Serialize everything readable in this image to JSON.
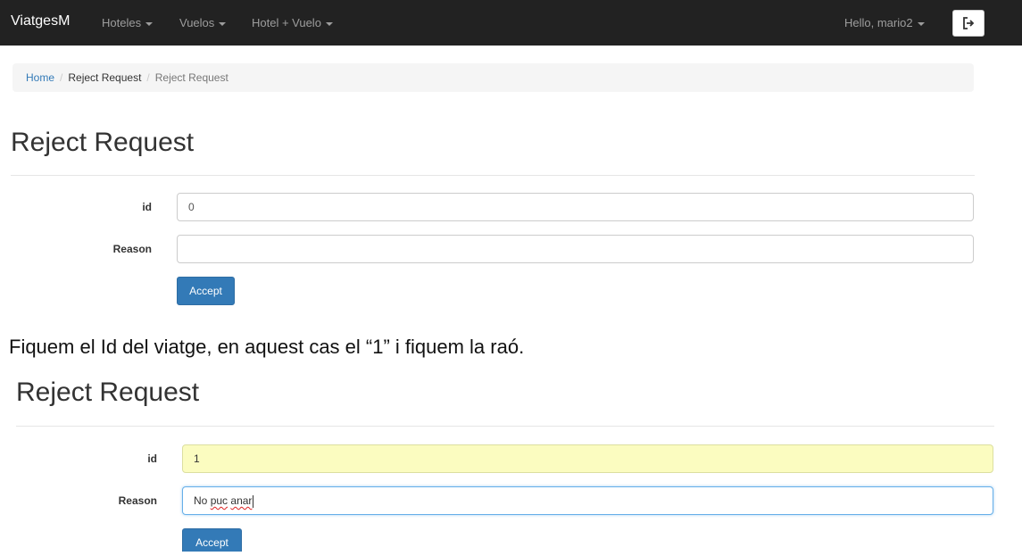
{
  "navbar": {
    "brand": "ViatgesM",
    "items": [
      {
        "label": "Hoteles"
      },
      {
        "label": "Vuelos"
      },
      {
        "label": "Hotel + Vuelo"
      }
    ],
    "user_label": "Hello, mario2",
    "logout_icon": "sign-out-icon"
  },
  "breadcrumb": {
    "home": "Home",
    "middle": "Reject Request",
    "current": "Reject Request"
  },
  "form1": {
    "title": "Reject Request",
    "id_label": "id",
    "id_value": "0",
    "reason_label": "Reason",
    "reason_value": "",
    "accept_label": "Accept"
  },
  "caption": "Fiquem el Id del viatge, en aquest cas el “1” i fiquem la raó.",
  "form2": {
    "title": "Reject Request",
    "id_label": "id",
    "id_value": "1",
    "reason_label": "Reason",
    "reason_value_plain": "No ",
    "reason_value_word1": "puc",
    "reason_value_space": " ",
    "reason_value_word2": "anar",
    "accept_label": "Accept"
  },
  "colors": {
    "navbar_bg": "#222222",
    "primary": "#337ab7",
    "autofill_yellow": "#fbfcc0",
    "focus_blue": "#66afe9"
  }
}
